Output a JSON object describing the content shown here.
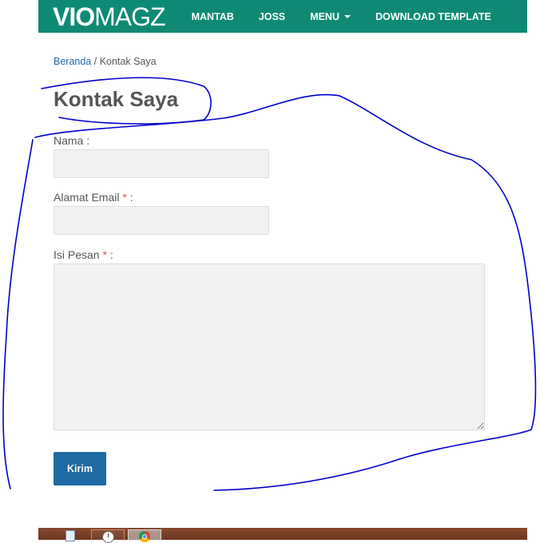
{
  "header": {
    "logo_strong": "VIO",
    "logo_light": "MAGZ",
    "nav": [
      "MANTAB",
      "JOSS",
      "MENU",
      "DOWNLOAD TEMPLATE"
    ]
  },
  "breadcrumb": {
    "home": "Beranda",
    "separator": " / ",
    "current": "Kontak Saya"
  },
  "page": {
    "title": "Kontak Saya"
  },
  "form": {
    "name_label": "Nama :",
    "email_label": "Alamat Email",
    "email_required": "*",
    "email_suffix": " :",
    "message_label": "Isi Pesan",
    "message_required": "*",
    "message_suffix": " :",
    "name_value": "",
    "email_value": "",
    "message_value": "",
    "submit_label": "Kirim"
  },
  "taskbar": {
    "items": [
      "notepad-icon",
      "clock-icon",
      "chrome-icon"
    ]
  },
  "colors": {
    "navbar": "#0e8a74",
    "link": "#1f67a8",
    "button": "#1e6aa2",
    "required": "#d9534f",
    "annotation": "#0000cc"
  }
}
